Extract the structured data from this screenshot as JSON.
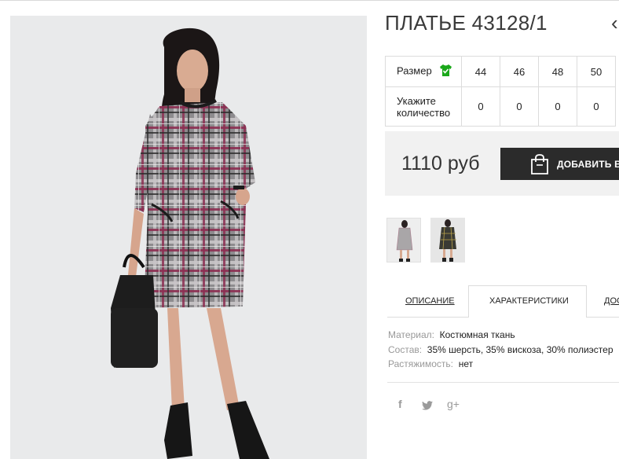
{
  "product": {
    "title": "ПЛАТЬЕ 43128/1",
    "title_overflow": "‹"
  },
  "sizes": {
    "size_label": "Размер",
    "qty_label": "Укажите количество",
    "size_icon": "tshirt-icon",
    "size_icon_color": "#1aa81a",
    "columns": [
      "44",
      "46",
      "48",
      "50"
    ],
    "quantities": [
      "0",
      "0",
      "0",
      "0"
    ]
  },
  "purchase": {
    "price": "1110 руб",
    "add_to_cart_label": "ДОБАВИТЬ В З",
    "cart_icon": "shopping-bag-icon"
  },
  "thumbnails": [
    {
      "name": "thumbnail-1"
    },
    {
      "name": "thumbnail-2"
    }
  ],
  "tabs": [
    {
      "label": "ОПИСАНИЕ",
      "active": false
    },
    {
      "label": "ХАРАКТЕРИСТИКИ",
      "active": true
    },
    {
      "label": "ДОС",
      "active": false
    }
  ],
  "specs": [
    {
      "key": "Материал:",
      "value": "Костюмная ткань"
    },
    {
      "key": "Состав:",
      "value": "35% шерсть, 35% вискоза, 30% полиэстер"
    },
    {
      "key": "Растяжимость:",
      "value": "нет"
    }
  ],
  "social": {
    "facebook": "f",
    "gplus": "g+"
  },
  "colors": {
    "dress_base": "#8a8a8a",
    "dress_check_pink": "#8c2f52",
    "dress_check_dark": "#2a2a2a",
    "button_bg": "#2b2b2b",
    "price_panel_bg": "#f1f1f1"
  }
}
